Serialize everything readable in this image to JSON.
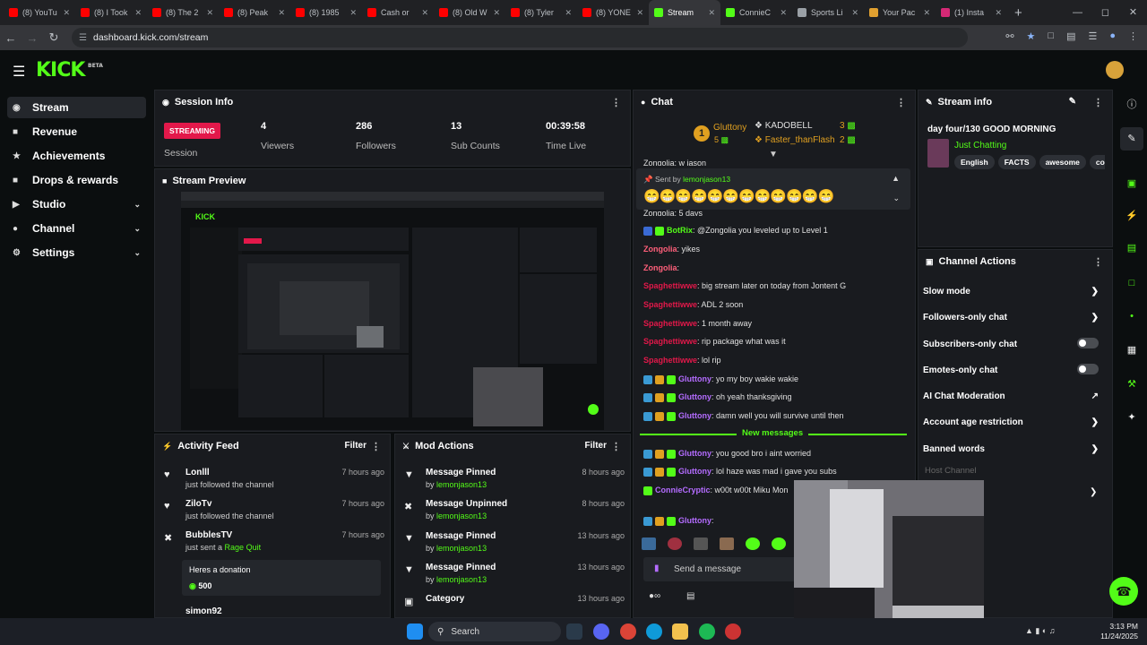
{
  "browser": {
    "tabs": [
      {
        "label": "(8) YouTu",
        "color": "#ff0000"
      },
      {
        "label": "(8) I Took",
        "color": "#ff0000"
      },
      {
        "label": "(8) The 2",
        "color": "#ff0000"
      },
      {
        "label": "(8) Peak",
        "color": "#ff0000"
      },
      {
        "label": "(8) 1985",
        "color": "#ff0000"
      },
      {
        "label": "Cash or",
        "color": "#ff0000"
      },
      {
        "label": "(8) Old W",
        "color": "#ff0000"
      },
      {
        "label": "(8) Tyler",
        "color": "#ff0000"
      },
      {
        "label": "(8) YONE",
        "color": "#ff0000"
      },
      {
        "label": "Stream",
        "color": "#53fc18"
      },
      {
        "label": "ConnieC",
        "color": "#53fc18"
      },
      {
        "label": "Sports Li",
        "color": "#9aa0a6"
      },
      {
        "label": "Your Pac",
        "color": "#e0a030"
      },
      {
        "label": "(1) Insta",
        "color": "#d62976"
      }
    ],
    "url": "dashboard.kick.com/stream"
  },
  "header": {
    "logo": "KICK",
    "logo_sup": "BETA"
  },
  "sidebar": {
    "items": [
      {
        "label": "Stream",
        "icon": "signal-icon"
      },
      {
        "label": "Revenue",
        "icon": "wallet-icon"
      },
      {
        "label": "Achievements",
        "icon": "trophy-icon"
      },
      {
        "label": "Drops & rewards",
        "icon": "gift-icon"
      },
      {
        "label": "Studio",
        "icon": "video-icon"
      },
      {
        "label": "Channel",
        "icon": "user-icon"
      },
      {
        "label": "Settings",
        "icon": "gear-icon"
      }
    ]
  },
  "session": {
    "title": "Session Info",
    "badge": "STREAMING",
    "session_label": "Session",
    "stats": [
      {
        "value": "4",
        "label": "Viewers"
      },
      {
        "value": "286",
        "label": "Followers"
      },
      {
        "value": "13",
        "label": "Sub Counts"
      },
      {
        "value": "00:39:58",
        "label": "Time Live"
      }
    ]
  },
  "preview": {
    "title": "Stream Preview"
  },
  "activity": {
    "title": "Activity Feed",
    "filter": "Filter",
    "items": [
      {
        "name": "Lonlll",
        "sub": "just followed the channel",
        "time": "7 hours ago"
      },
      {
        "name": "ZiloTv",
        "sub": "just followed the channel",
        "time": "7 hours ago"
      },
      {
        "name": "BubblesTV",
        "sub": "just sent a",
        "sub_link": "Rage Quit",
        "time": "7 hours ago"
      }
    ],
    "donation_msg": "Heres a donation",
    "donation_amount": "500",
    "cut_name": "simon92"
  },
  "mod": {
    "title": "Mod Actions",
    "filter": "Filter",
    "items": [
      {
        "action": "Message Pinned",
        "by": "by",
        "user": "lemonjason13",
        "time": "8 hours ago"
      },
      {
        "action": "Message Unpinned",
        "by": "by",
        "user": "lemonjason13",
        "time": "8 hours ago"
      },
      {
        "action": "Message Pinned",
        "by": "by",
        "user": "lemonjason13",
        "time": "13 hours ago"
      },
      {
        "action": "Message Pinned",
        "by": "by",
        "user": "lemonjason13",
        "time": "13 hours ago"
      },
      {
        "action": "Category",
        "by": "",
        "user": "",
        "time": "13 hours ago"
      }
    ]
  },
  "chat": {
    "title": "Chat",
    "gifters": {
      "first_name": "Gluttony",
      "first_count": "5",
      "second_name": "KADOBELL",
      "second_count": "3",
      "third_name": "Faster_thanFlash",
      "third_count": "2",
      "rank": "1"
    },
    "pinned_sent_by": "Sent by",
    "pinned_user": "lemonjason13",
    "pinned_emotes": "😁😁😁😁😁😁😁😁😁😁😁😁",
    "partial_top": "Zongolia: w jason",
    "partial_mid": "Zongolia: 5 days",
    "messages": [
      {
        "user": "BotRix",
        "text": ": @Zongolia you leveled up to Level 1",
        "color": "#53fc18"
      },
      {
        "user": "Zongolia",
        "text": ": yikes",
        "color": "#ff5f7a"
      },
      {
        "user": "Zongolia",
        "text": ":",
        "color": "#ff5f7a"
      },
      {
        "user": "Spaghettiwwe",
        "text": ": big stream later on today from Jontent G",
        "color": "#e3184a"
      },
      {
        "user": "Spaghettiwwe",
        "text": ": ADL 2 soon",
        "color": "#e3184a"
      },
      {
        "user": "Spaghettiwwe",
        "text": ": 1 month away",
        "color": "#e3184a"
      },
      {
        "user": "Spaghettiwwe",
        "text": ": rip package what was it",
        "color": "#e3184a"
      },
      {
        "user": "Spaghettiwwe",
        "text": ": lol rip",
        "color": "#e3184a"
      },
      {
        "user": "Gluttony",
        "text": ": yo my boy wakie wakie",
        "color": "#b46cff"
      },
      {
        "user": "Gluttony",
        "text": ": oh yeah thanksgiving",
        "color": "#b46cff"
      },
      {
        "user": "Gluttony",
        "text": ": damn well you will survive until then",
        "color": "#b46cff"
      }
    ],
    "new_messages": "New messages",
    "messages2": [
      {
        "user": "Gluttony",
        "text": ": you good bro i aint worried",
        "color": "#b46cff"
      },
      {
        "user": "Gluttony",
        "text": ": lol haze was mad i gave you subs",
        "color": "#b46cff"
      },
      {
        "user": "ConnieCryptic",
        "text": ": w00t w00t Miku Mon",
        "color": "#b46cff"
      },
      {
        "user": "Gluttony",
        "text": ":",
        "color": "#b46cff"
      }
    ],
    "input_placeholder": "Send a message"
  },
  "stream_info": {
    "title": "Stream info",
    "stream_title": "day four/130 GOOD MORNING",
    "category": "Just Chatting",
    "tags": [
      "English",
      "FACTS",
      "awesome",
      "cons"
    ]
  },
  "channel_actions": {
    "title": "Channel Actions",
    "items": [
      {
        "label": "Slow mode",
        "control": "chevron"
      },
      {
        "label": "Followers-only chat",
        "control": "chevron"
      },
      {
        "label": "Subscribers-only chat",
        "control": "toggle"
      },
      {
        "label": "Emotes-only chat",
        "control": "toggle"
      },
      {
        "label": "AI Chat Moderation",
        "control": "external"
      },
      {
        "label": "Account age restriction",
        "control": "chevron"
      },
      {
        "label": "Banned words",
        "control": "chevron"
      }
    ],
    "host_label": "Host Channel"
  },
  "taskbar": {
    "search": "Search",
    "time": "3:13 PM",
    "date": "11/24/2025"
  },
  "colors": {
    "accent": "#53fc18",
    "streaming": "#e3184a",
    "panel": "#191b1f"
  }
}
